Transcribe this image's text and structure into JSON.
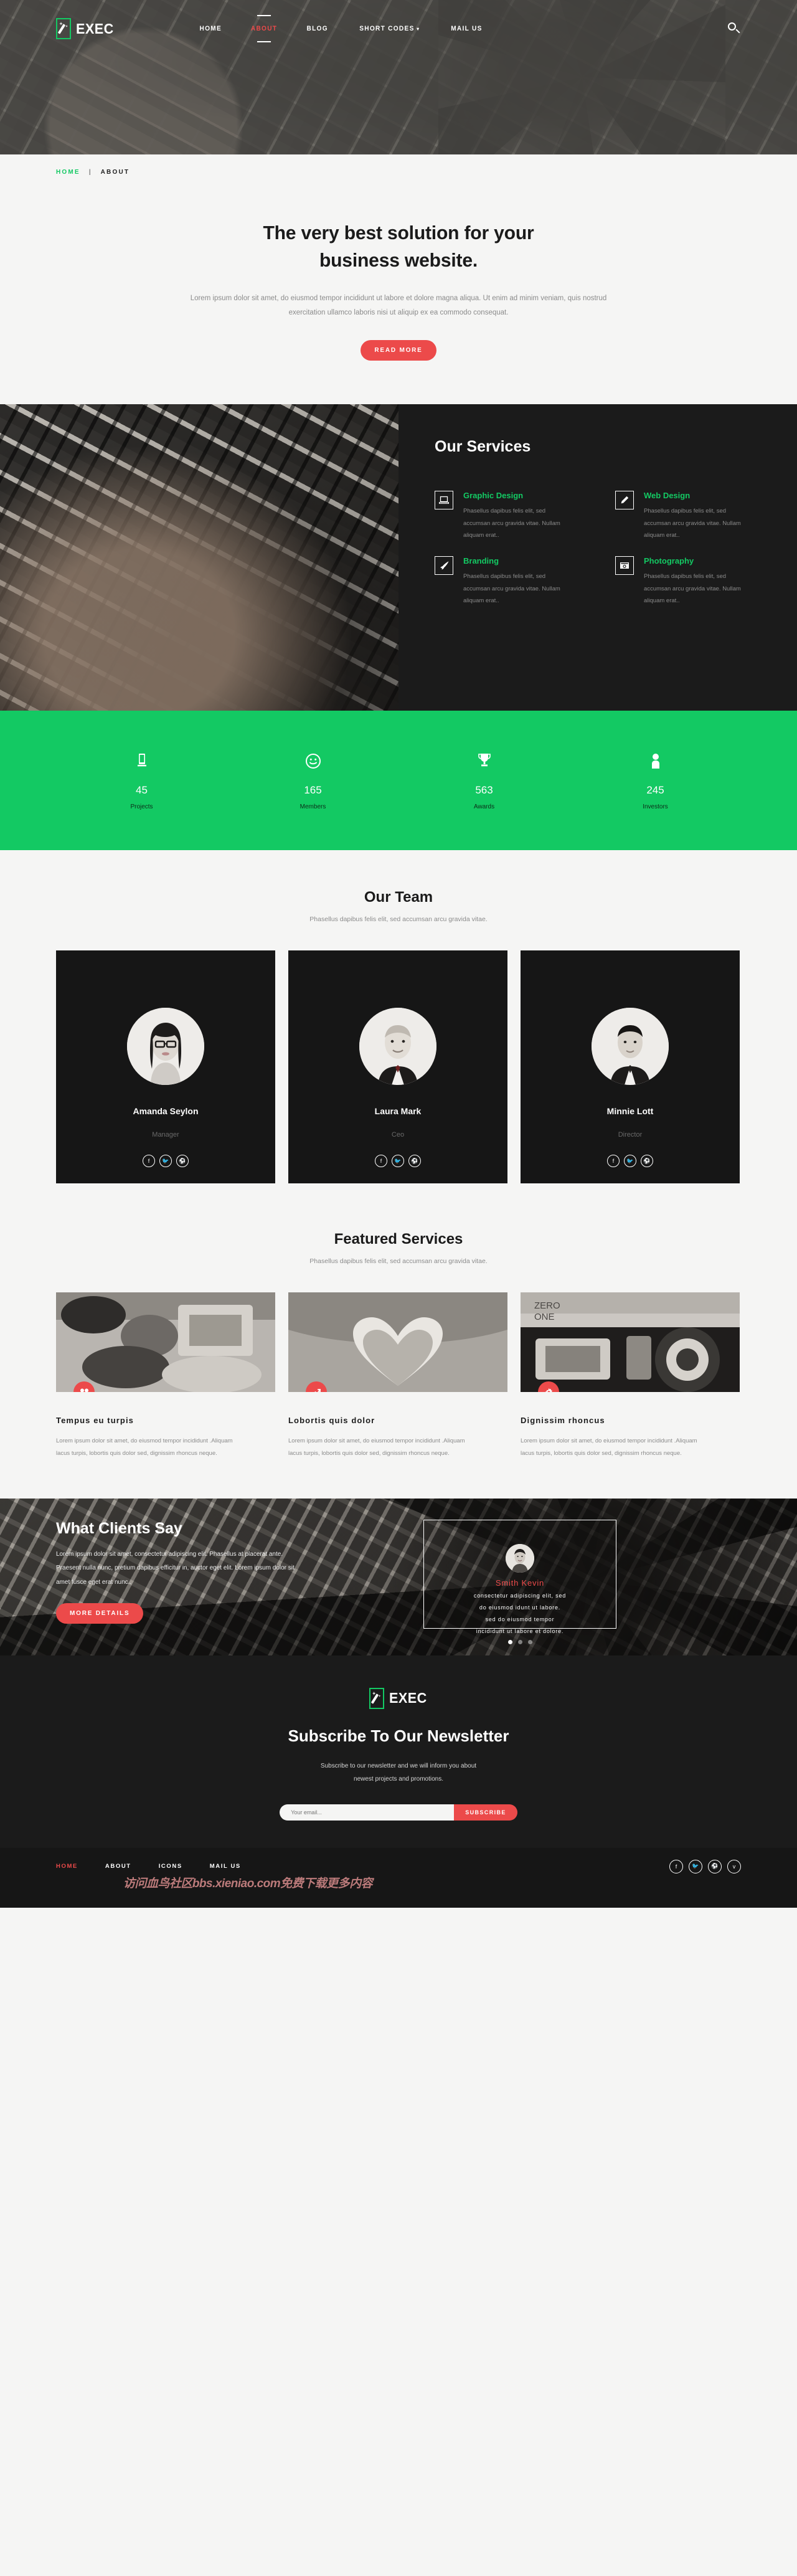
{
  "brand": {
    "name": "EXEC",
    "mark_icon": "magic-wand-icon",
    "accent_green": "#13c963",
    "accent_red": "#ec4a4a"
  },
  "header": {
    "nav": [
      {
        "label": "HOME",
        "active": false
      },
      {
        "label": "ABOUT",
        "active": true
      },
      {
        "label": "BLOG",
        "active": false
      },
      {
        "label": "SHORT CODES",
        "active": false,
        "caret": "▾"
      },
      {
        "label": "MAIL US",
        "active": false
      }
    ],
    "search_icon": "search-icon"
  },
  "breadcrumb": {
    "home": "HOME",
    "separator": "|",
    "current": "ABOUT"
  },
  "intro": {
    "heading_line1": "The very best solution for your",
    "heading_line2": "business website.",
    "paragraph": "Lorem ipsum dolor sit amet, do eiusmod tempor incididunt ut labore et dolore magna aliqua. Ut enim ad minim veniam, quis nostrud exercitation ullamco laboris nisi ut aliquip ex ea commodo consequat.",
    "button": "READ MORE"
  },
  "services": {
    "title": "Our Services",
    "items": [
      {
        "icon": "laptop-icon",
        "title": "Graphic Design",
        "text": "Phasellus dapibus felis elit, sed accumsan arcu gravida vitae. Nullam aliquam erat.."
      },
      {
        "icon": "pencil-icon",
        "title": "Web Design",
        "text": "Phasellus dapibus felis elit, sed accumsan arcu gravida vitae. Nullam aliquam erat.."
      },
      {
        "icon": "brush-icon",
        "title": "Branding",
        "text": "Phasellus dapibus felis elit, sed accumsan arcu gravida vitae. Nullam aliquam erat.."
      },
      {
        "icon": "camera-icon",
        "title": "Photography",
        "text": "Phasellus dapibus felis elit, sed accumsan arcu gravida vitae. Nullam aliquam erat.."
      }
    ]
  },
  "stats": [
    {
      "icon": "monitor-icon",
      "value": "45",
      "label": "Projects"
    },
    {
      "icon": "smiley-icon",
      "value": "165",
      "label": "Members"
    },
    {
      "icon": "trophy-icon",
      "value": "563",
      "label": "Awards"
    },
    {
      "icon": "person-icon",
      "value": "245",
      "label": "Investors"
    }
  ],
  "team": {
    "title": "Our Team",
    "subtitle": "Phasellus dapibus felis elit, sed accumsan arcu gravida vitae.",
    "members": [
      {
        "name": "Amanda Seylon",
        "role": "Manager",
        "socials": [
          "facebook-icon",
          "twitter-icon",
          "dribbble-icon"
        ]
      },
      {
        "name": "Laura Mark",
        "role": "Ceo",
        "socials": [
          "facebook-icon",
          "twitter-icon",
          "dribbble-icon"
        ]
      },
      {
        "name": "Minnie Lott",
        "role": "Director",
        "socials": [
          "facebook-icon",
          "twitter-icon",
          "dribbble-icon"
        ]
      }
    ]
  },
  "featured": {
    "title": "Featured Services",
    "subtitle": "Phasellus dapibus felis elit, sed accumsan arcu gravida vitae.",
    "items": [
      {
        "badge_icon": "cubes-icon",
        "title": "Tempus eu turpis",
        "text": "Lorem ipsum dolor sit amet, do eiusmod tempor incididunt .Aliquam lacus turpis, lobortis quis dolor sed, dignissim rhoncus neque."
      },
      {
        "badge_icon": "chart-line-icon",
        "title": "Lobortis quis dolor",
        "text": "Lorem ipsum dolor sit amet, do eiusmod tempor incididunt .Aliquam lacus turpis, lobortis quis dolor sed, dignissim rhoncus neque."
      },
      {
        "badge_icon": "gear-icon",
        "title": "Dignissim rhoncus",
        "text": "Lorem ipsum dolor sit amet, do eiusmod tempor incididunt .Aliquam lacus turpis, lobortis quis dolor sed, dignissim rhoncus neque."
      }
    ]
  },
  "testimonial": {
    "title": "What Clients Say",
    "text": "Lorem ipsum dolor sit amet, consectetur adipiscing elit. Phasellus at placerat ante. Praesent nulla nunc, pretium dapibus efficitur in, auctor eget elit. Lorem ipsum dolor sit amet fusce eget erat nunc..",
    "button": "MORE DETAILS",
    "quote_name": "Smith Kevin",
    "quote_line1": "consectetur adipiscing elit, sed",
    "quote_line2": "do eiusmod idunt ut labore.",
    "quote_line3": "sed do eiusmod tempor",
    "quote_line4": "incididunt ut labore et dolore.",
    "dots": 3,
    "active_dot": 0
  },
  "newsletter": {
    "brand": "EXEC",
    "title": "Subscribe To Our Newsletter",
    "line1": "Subscribe to our newsletter and we will inform you about",
    "line2": "newest projects and promotions.",
    "placeholder": "Your email...",
    "value": "",
    "button": "SUBSCRIBE"
  },
  "footer": {
    "nav": [
      {
        "label": "HOME",
        "active": true
      },
      {
        "label": "ABOUT",
        "active": false
      },
      {
        "label": "ICONS",
        "active": false
      },
      {
        "label": "MAIL US",
        "active": false
      }
    ],
    "socials": [
      "facebook-icon",
      "twitter-icon",
      "dribbble-icon",
      "vimeo-icon"
    ],
    "watermark": "访问血鸟社区bbs.xieniao.com免费下载更多内容"
  }
}
